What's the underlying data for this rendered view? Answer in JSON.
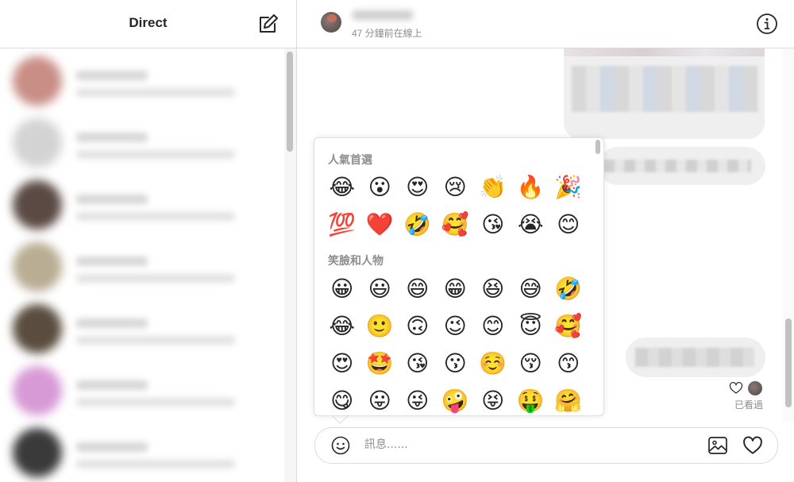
{
  "sidebar": {
    "title": "Direct",
    "compose_icon": "compose-icon",
    "conversations": [
      {
        "avatar_color": "#c98e86"
      },
      {
        "avatar_color": "#d3d3d3"
      },
      {
        "avatar_color": "#5b4a44"
      },
      {
        "avatar_color": "#b9ad93"
      },
      {
        "avatar_color": "#5a4d3f"
      },
      {
        "avatar_color": "#d79ad6"
      },
      {
        "avatar_color": "#3a3a3a"
      }
    ]
  },
  "chat": {
    "status": "47 分鐘前在線上",
    "info_icon": "info-icon",
    "seen_label": "已看過"
  },
  "composer": {
    "placeholder": "訊息......",
    "emoji_icon": "smiley-icon",
    "image_icon": "image-icon",
    "like_icon": "heart-icon"
  },
  "emoji_picker": {
    "sections": [
      {
        "title": "人氣首選",
        "emojis": [
          "😂",
          "😮",
          "😍",
          "😢",
          "👏",
          "🔥",
          "🎉",
          "💯",
          "❤️",
          "🤣",
          "🥰",
          "😘",
          "😭",
          "😊"
        ]
      },
      {
        "title": "笑臉和人物",
        "emojis": [
          "😀",
          "😃",
          "😄",
          "😁",
          "😆",
          "😅",
          "🤣",
          "😂",
          "🙂",
          "🙃",
          "😉",
          "😊",
          "😇",
          "🥰",
          "😍",
          "🤩",
          "😘",
          "😗",
          "☺️",
          "😚",
          "😙",
          "😋",
          "😛",
          "😜",
          "🤪",
          "😝",
          "🤑",
          "🤗"
        ]
      }
    ]
  }
}
